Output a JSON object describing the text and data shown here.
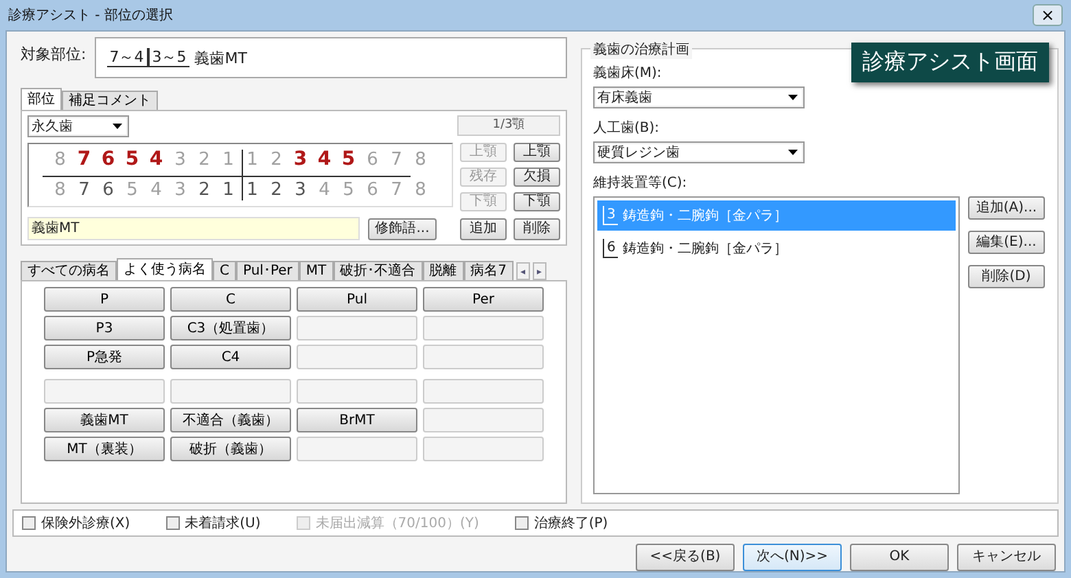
{
  "window": {
    "title": "診療アシスト - 部位の選択",
    "close": "×"
  },
  "target": {
    "label": "対象部位:",
    "segments": [
      {
        "text": "7～4",
        "right_line": true,
        "left_line": false
      },
      {
        "text": "3～5",
        "right_line": false,
        "left_line": true
      }
    ],
    "suffix": "義歯MT"
  },
  "site_tabs": [
    {
      "label": "部位",
      "selected": true
    },
    {
      "label": "補足コメント",
      "selected": false
    }
  ],
  "dentition": {
    "value": "永久歯",
    "jaw_label": "1/3顎"
  },
  "teeth": {
    "upper_right": [
      {
        "n": "8",
        "selected": false,
        "present": false
      },
      {
        "n": "7",
        "selected": true,
        "present": false
      },
      {
        "n": "6",
        "selected": true,
        "present": false
      },
      {
        "n": "5",
        "selected": true,
        "present": false
      },
      {
        "n": "4",
        "selected": true,
        "present": false
      },
      {
        "n": "3",
        "selected": false,
        "present": false
      },
      {
        "n": "2",
        "selected": false,
        "present": false
      },
      {
        "n": "1",
        "selected": false,
        "present": false
      }
    ],
    "upper_left": [
      {
        "n": "1",
        "selected": false,
        "present": false
      },
      {
        "n": "2",
        "selected": false,
        "present": false
      },
      {
        "n": "3",
        "selected": true,
        "present": false
      },
      {
        "n": "4",
        "selected": true,
        "present": false
      },
      {
        "n": "5",
        "selected": true,
        "present": false
      },
      {
        "n": "6",
        "selected": false,
        "present": false
      },
      {
        "n": "7",
        "selected": false,
        "present": false
      },
      {
        "n": "8",
        "selected": false,
        "present": false
      }
    ],
    "lower_right": [
      {
        "n": "8",
        "selected": false,
        "present": false
      },
      {
        "n": "7",
        "selected": false,
        "present": true
      },
      {
        "n": "6",
        "selected": false,
        "present": true
      },
      {
        "n": "5",
        "selected": false,
        "present": false
      },
      {
        "n": "4",
        "selected": false,
        "present": false
      },
      {
        "n": "3",
        "selected": false,
        "present": false
      },
      {
        "n": "2",
        "selected": false,
        "present": true
      },
      {
        "n": "1",
        "selected": false,
        "present": true
      }
    ],
    "lower_left": [
      {
        "n": "1",
        "selected": false,
        "present": true
      },
      {
        "n": "2",
        "selected": false,
        "present": true
      },
      {
        "n": "3",
        "selected": false,
        "present": true
      },
      {
        "n": "4",
        "selected": false,
        "present": false
      },
      {
        "n": "5",
        "selected": false,
        "present": false
      },
      {
        "n": "6",
        "selected": false,
        "present": false
      },
      {
        "n": "7",
        "selected": false,
        "present": false
      },
      {
        "n": "8",
        "selected": false,
        "present": false
      }
    ]
  },
  "jaw_buttons": [
    {
      "label": "上顎",
      "disabled": true
    },
    {
      "label": "上顎",
      "disabled": false
    },
    {
      "label": "残存",
      "disabled": true
    },
    {
      "label": "欠損",
      "disabled": false
    },
    {
      "label": "下顎",
      "disabled": true
    },
    {
      "label": "下顎",
      "disabled": false
    }
  ],
  "disease_field": {
    "value": "義歯MT"
  },
  "modifier_button": "修飾語...",
  "site_buttons": [
    "追加",
    "削除"
  ],
  "disease_tabs": [
    {
      "label": "すべての病名",
      "selected": false
    },
    {
      "label": "よく使う病名",
      "selected": true
    },
    {
      "label": "C",
      "selected": false
    },
    {
      "label": "Pul･Per",
      "selected": false
    },
    {
      "label": "MT",
      "selected": false
    },
    {
      "label": "破折･不適合",
      "selected": false
    },
    {
      "label": "脱離",
      "selected": false
    },
    {
      "label": "病名7",
      "selected": false
    }
  ],
  "tab_scroll": [
    "◂",
    "▸"
  ],
  "disease_grid": [
    [
      {
        "label": "P",
        "disabled": false
      },
      {
        "label": "C",
        "disabled": false
      },
      {
        "label": "Pul",
        "disabled": false
      },
      {
        "label": "Per",
        "disabled": false
      }
    ],
    [
      {
        "label": "P3",
        "disabled": false
      },
      {
        "label": "C3（処置歯）",
        "disabled": false
      },
      {
        "disabled": true
      },
      {
        "disabled": true
      }
    ],
    [
      {
        "label": "P急発",
        "disabled": false
      },
      {
        "label": "C4",
        "disabled": false
      },
      {
        "disabled": true
      },
      {
        "disabled": true
      }
    ],
    [
      {
        "disabled": true
      },
      {
        "disabled": true
      },
      {
        "disabled": true
      },
      {
        "disabled": true
      }
    ],
    [
      {
        "label": "義歯MT",
        "disabled": false
      },
      {
        "label": "不適合（義歯）",
        "disabled": false
      },
      {
        "label": "BrMT",
        "disabled": false
      },
      {
        "disabled": true
      }
    ],
    [
      {
        "label": "MT（裏装）",
        "disabled": false
      },
      {
        "label": "破折（義歯）",
        "disabled": false
      },
      {
        "disabled": true
      },
      {
        "disabled": true
      }
    ]
  ],
  "plan": {
    "title": "義歯の治療計画",
    "badge": "診療アシスト画面",
    "base_label": "義歯床(M):",
    "base_value": "有床義歯",
    "teeth_label": "人工歯(B):",
    "teeth_value": "硬質レジン歯",
    "retainer_label": "維持装置等(C):",
    "retainers": [
      {
        "tooth": "3",
        "text": "鋳造鉤・二腕鉤［金パラ］",
        "selected": true
      },
      {
        "tooth": "6",
        "text": "鋳造鉤・二腕鉤［金パラ］",
        "selected": false
      }
    ],
    "buttons": [
      "追加(A)...",
      "編集(E)...",
      "削除(D)"
    ]
  },
  "options": [
    {
      "label": "保険外診療(X)",
      "checked": false,
      "disabled": false
    },
    {
      "label": "未着請求(U)",
      "checked": false,
      "disabled": false
    },
    {
      "label": "未届出減算（70/100）(Y)",
      "checked": false,
      "disabled": true
    },
    {
      "label": "治療終了(P)",
      "checked": false,
      "disabled": false
    }
  ],
  "footer_buttons": [
    {
      "label": "<<戻る(B)",
      "focused": false
    },
    {
      "label": "次へ(N)>>",
      "focused": true
    },
    {
      "label": "OK",
      "focused": false
    },
    {
      "label": "キャンセル",
      "focused": false
    }
  ]
}
